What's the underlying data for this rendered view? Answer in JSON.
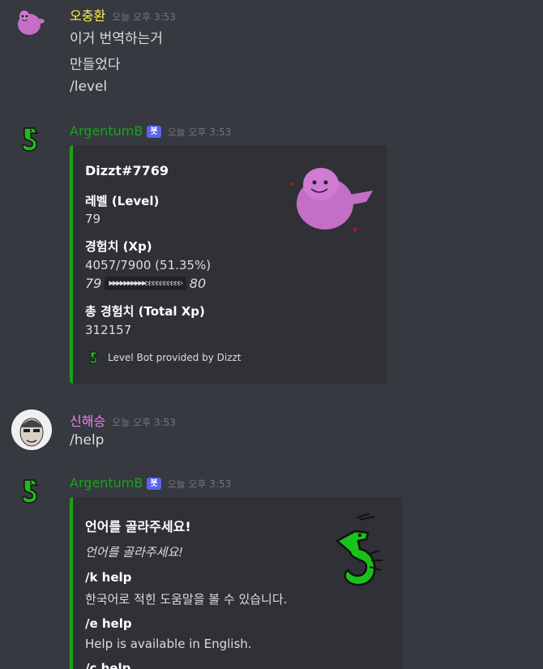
{
  "messages": [
    {
      "username": "오충환",
      "username_color": "#fff04a",
      "timestamp": "오늘 오후 3:53",
      "lines": [
        "이거 번역하는거",
        "만들었다",
        "/level"
      ]
    },
    {
      "username": "ArgentumB",
      "username_color": "#1aa21a",
      "bot_tag": "봇",
      "timestamp": "오늘 오후 3:53",
      "embed": {
        "title": "Dizzt#7769",
        "fields": [
          {
            "name": "레벨 (Level)",
            "value": "79"
          },
          {
            "name": "경험치 (Xp)",
            "value": "4057/7900 (51.35%)"
          },
          {
            "name": "총 경험치 (Total Xp)",
            "value": "312157"
          }
        ],
        "progress": {
          "from": "79",
          "bar": "▶▶▶▶▶▶▶▶▶▶▷▷▷▷▷▷▷▷▷▷",
          "to": "80",
          "fraction": 0.5135
        },
        "footer": "Level Bot provided by Dizzt"
      }
    },
    {
      "username": "신해승",
      "username_color": "#f47fff",
      "timestamp": "오늘 오후 3:53",
      "lines": [
        "/help"
      ]
    },
    {
      "username": "ArgentumB",
      "username_color": "#1aa21a",
      "bot_tag": "봇",
      "timestamp": "오늘 오후 3:53",
      "embed": {
        "title": "언어를 골라주세요!",
        "description": "언어를 골라주세요!",
        "fields": [
          {
            "name": "/k help",
            "value": "한국어로 적힌 도움말을 볼 수 있습니다."
          },
          {
            "name": "/e help",
            "value": "Help is available in English."
          },
          {
            "name": "/c help",
            "value": ""
          }
        ]
      }
    }
  ]
}
